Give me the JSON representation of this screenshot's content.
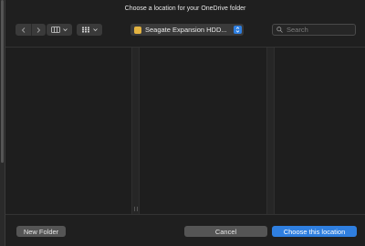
{
  "dialog": {
    "title": "Choose a location for your OneDrive folder"
  },
  "toolbar": {
    "back_icon": "chevron-left-icon",
    "forward_icon": "chevron-right-icon",
    "columns_view_icon": "columns-view-icon",
    "grid_view_icon": "grid-view-icon",
    "location": {
      "selected": "Seagate Expansion HDD...",
      "icon": "external-drive-icon"
    },
    "search": {
      "placeholder": "Search",
      "value": ""
    }
  },
  "footer": {
    "new_folder_label": "New Folder",
    "cancel_label": "Cancel",
    "choose_label": "Choose this location"
  },
  "colors": {
    "accent": "#2f7fe0",
    "background": "#1f1f1f",
    "drive_icon": "#e3b341"
  }
}
